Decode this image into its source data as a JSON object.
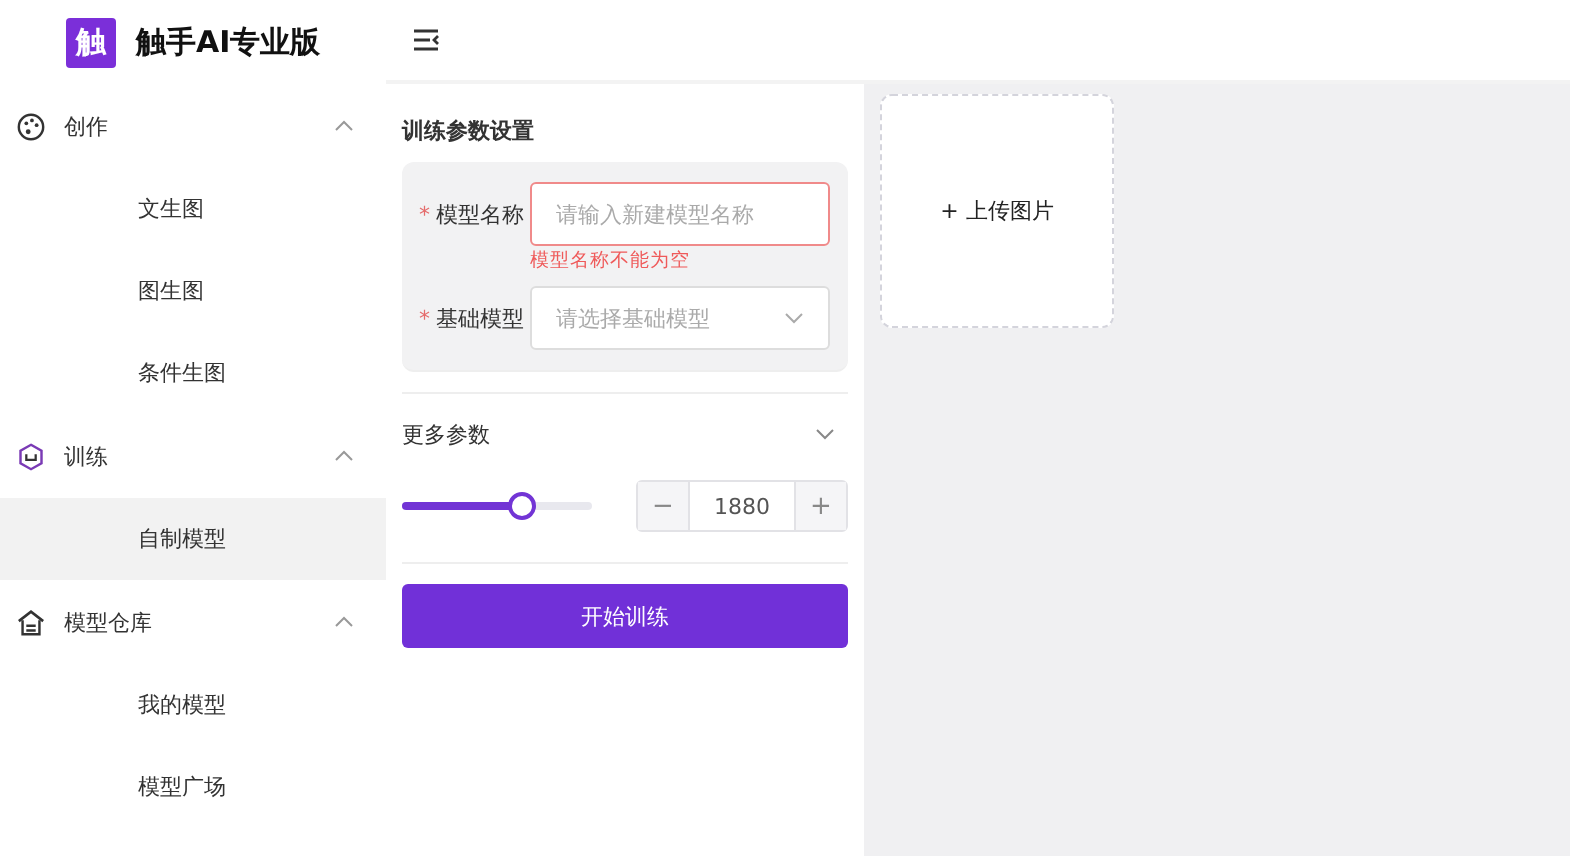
{
  "app": {
    "title": "触手AI专业版",
    "logo_text": "触"
  },
  "sidebar": {
    "groups": [
      {
        "label": "创作",
        "expanded": true,
        "items": [
          {
            "label": "文生图",
            "selected": false
          },
          {
            "label": "图生图",
            "selected": false
          },
          {
            "label": "条件生图",
            "selected": false
          }
        ]
      },
      {
        "label": "训练",
        "expanded": true,
        "items": [
          {
            "label": "自制模型",
            "selected": true
          }
        ]
      },
      {
        "label": "模型仓库",
        "expanded": true,
        "items": [
          {
            "label": "我的模型",
            "selected": false
          },
          {
            "label": "模型广场",
            "selected": false
          }
        ]
      }
    ]
  },
  "form": {
    "title": "训练参数设置",
    "fields": [
      {
        "kind": "text",
        "label": "模型名称",
        "required_mark": "*",
        "placeholder": "请输入新建模型名称",
        "error": "模型名称不能为空"
      },
      {
        "kind": "select",
        "label": "基础模型",
        "required_mark": "*",
        "placeholder": "请选择基础模型"
      }
    ],
    "more": {
      "label": "更多参数",
      "expanded": false
    },
    "slider": {
      "level": 0.62
    },
    "stepper": {
      "minus": "−",
      "value": "1880",
      "plus": "+"
    },
    "submit": "开始训练"
  },
  "upload": {
    "label": "+ 上传图片"
  }
}
